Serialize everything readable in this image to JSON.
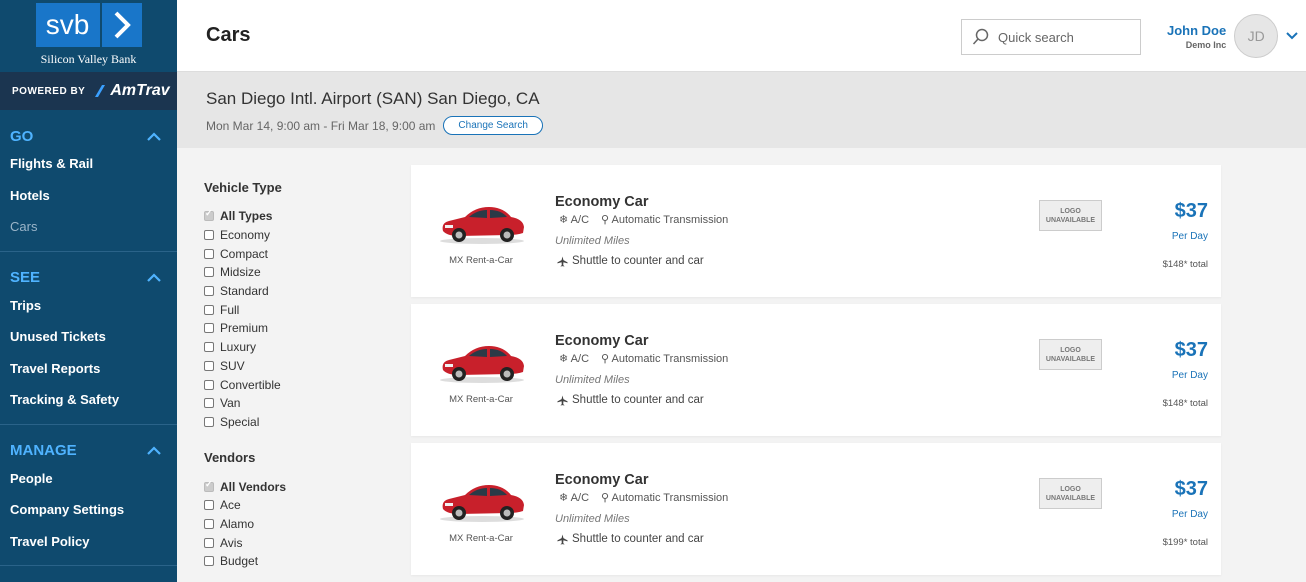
{
  "brand": {
    "short": "svb",
    "full_name": "Silicon Valley Bank",
    "powered_by": "POWERED BY",
    "partner": "AmTrav"
  },
  "sidebar": {
    "sections": [
      {
        "label": "GO",
        "items": [
          {
            "label": "Flights & Rail"
          },
          {
            "label": "Hotels"
          },
          {
            "label": "Cars",
            "active": true
          }
        ]
      },
      {
        "label": "SEE",
        "items": [
          {
            "label": "Trips"
          },
          {
            "label": "Unused Tickets"
          },
          {
            "label": "Travel Reports"
          },
          {
            "label": "Tracking & Safety"
          }
        ]
      },
      {
        "label": "MANAGE",
        "items": [
          {
            "label": "People"
          },
          {
            "label": "Company Settings"
          },
          {
            "label": "Travel Policy"
          }
        ]
      }
    ]
  },
  "header": {
    "title": "Cars",
    "search_placeholder": "Quick search",
    "user_name": "John Doe",
    "user_company": "Demo Inc",
    "user_initials": "JD"
  },
  "trip": {
    "location": "San Diego Intl. Airport (SAN) San Diego, CA",
    "dates": "Mon Mar 14, 9:00 am - Fri Mar 18, 9:00 am",
    "change_label": "Change Search"
  },
  "filters": {
    "vehicle_title": "Vehicle Type",
    "vehicle_types": [
      "All Types",
      "Economy",
      "Compact",
      "Midsize",
      "Standard",
      "Full",
      "Premium",
      "Luxury",
      "SUV",
      "Convertible",
      "Van",
      "Special"
    ],
    "vendors_title": "Vendors",
    "vendors": [
      "All Vendors",
      "Ace",
      "Alamo",
      "Avis",
      "Budget"
    ]
  },
  "results": [
    {
      "vendor": "MX Rent-a-Car",
      "title": "Economy Car",
      "ac": "A/C",
      "transmission": "Automatic Transmission",
      "miles": "Unlimited Miles",
      "shuttle": "Shuttle to counter and car",
      "logo": "LOGO UNAVAILABLE",
      "price": "$37",
      "per_day": "Per Day",
      "total": "$148* total"
    },
    {
      "vendor": "MX Rent-a-Car",
      "title": "Economy Car",
      "ac": "A/C",
      "transmission": "Automatic Transmission",
      "miles": "Unlimited Miles",
      "shuttle": "Shuttle to counter and car",
      "logo": "LOGO UNAVAILABLE",
      "price": "$37",
      "per_day": "Per Day",
      "total": "$148* total"
    },
    {
      "vendor": "MX Rent-a-Car",
      "title": "Economy Car",
      "ac": "A/C",
      "transmission": "Automatic Transmission",
      "miles": "Unlimited Miles",
      "shuttle": "Shuttle to counter and car",
      "logo": "LOGO UNAVAILABLE",
      "price": "$37",
      "per_day": "Per Day",
      "total": "$199* total"
    }
  ],
  "colors": {
    "sidebar_bg": "#0f4a6e",
    "accent": "#1a73b8",
    "nav_head": "#4fb3ff",
    "car_red": "#c8202b"
  }
}
